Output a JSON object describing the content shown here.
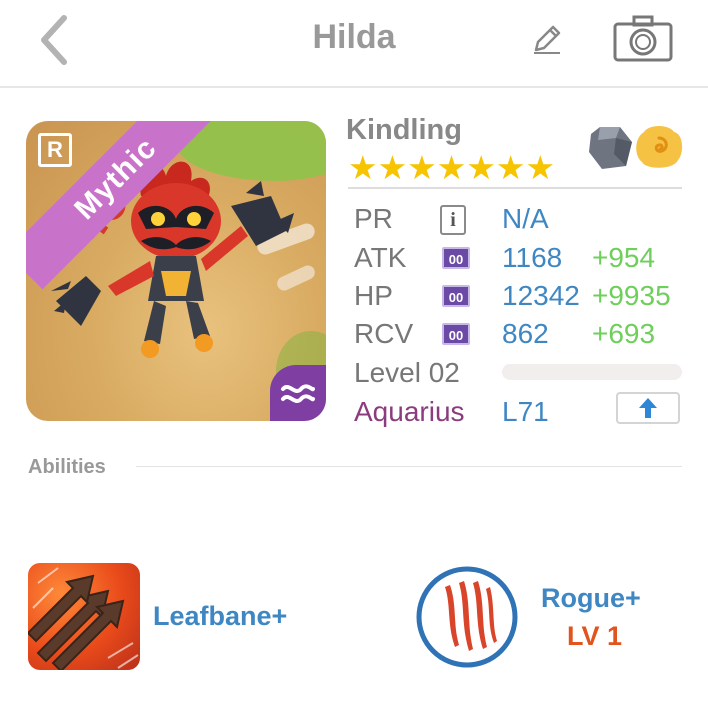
{
  "header": {
    "title": "Hilda",
    "back_icon": "chevron-left-icon",
    "edit_icon": "pencil-icon",
    "camera_icon": "camera-icon"
  },
  "portrait": {
    "ribbon_label": "Mythic",
    "rarity_letter": "R",
    "element_icon": "water-waves-icon",
    "ribbon_color": "#c873c9"
  },
  "info": {
    "name": "Kindling",
    "stars": "★★★★★★★",
    "star_count": 7,
    "gems": [
      "gray-stone-icon",
      "gold-swirl-icon"
    ],
    "stats": [
      {
        "label": "PR",
        "value": "N/A",
        "bonus": "",
        "marker": "info-icon"
      },
      {
        "label": "ATK",
        "chip": "00",
        "value": "1168",
        "bonus": "+954"
      },
      {
        "label": "HP",
        "chip": "00",
        "value": "12342",
        "bonus": "+9935"
      },
      {
        "label": "RCV",
        "chip": "00",
        "value": "862",
        "bonus": "+693"
      }
    ],
    "level": {
      "label": "Level 02",
      "progress": 0.0
    },
    "sign": {
      "label": "Aquarius",
      "value": "L71",
      "upgrade_icon": "up-arrow-icon"
    },
    "colors": {
      "value": "#3f87c3",
      "bonus": "#6ecf5a",
      "sign": "#8b3c7e"
    }
  },
  "abilities": {
    "heading": "Abilities",
    "items": [
      {
        "name": "Leafbane+",
        "icon": "triple-arrows-icon"
      },
      {
        "name": "Rogue+",
        "level": "LV 1",
        "icon": "claw-marks-icon"
      }
    ]
  }
}
